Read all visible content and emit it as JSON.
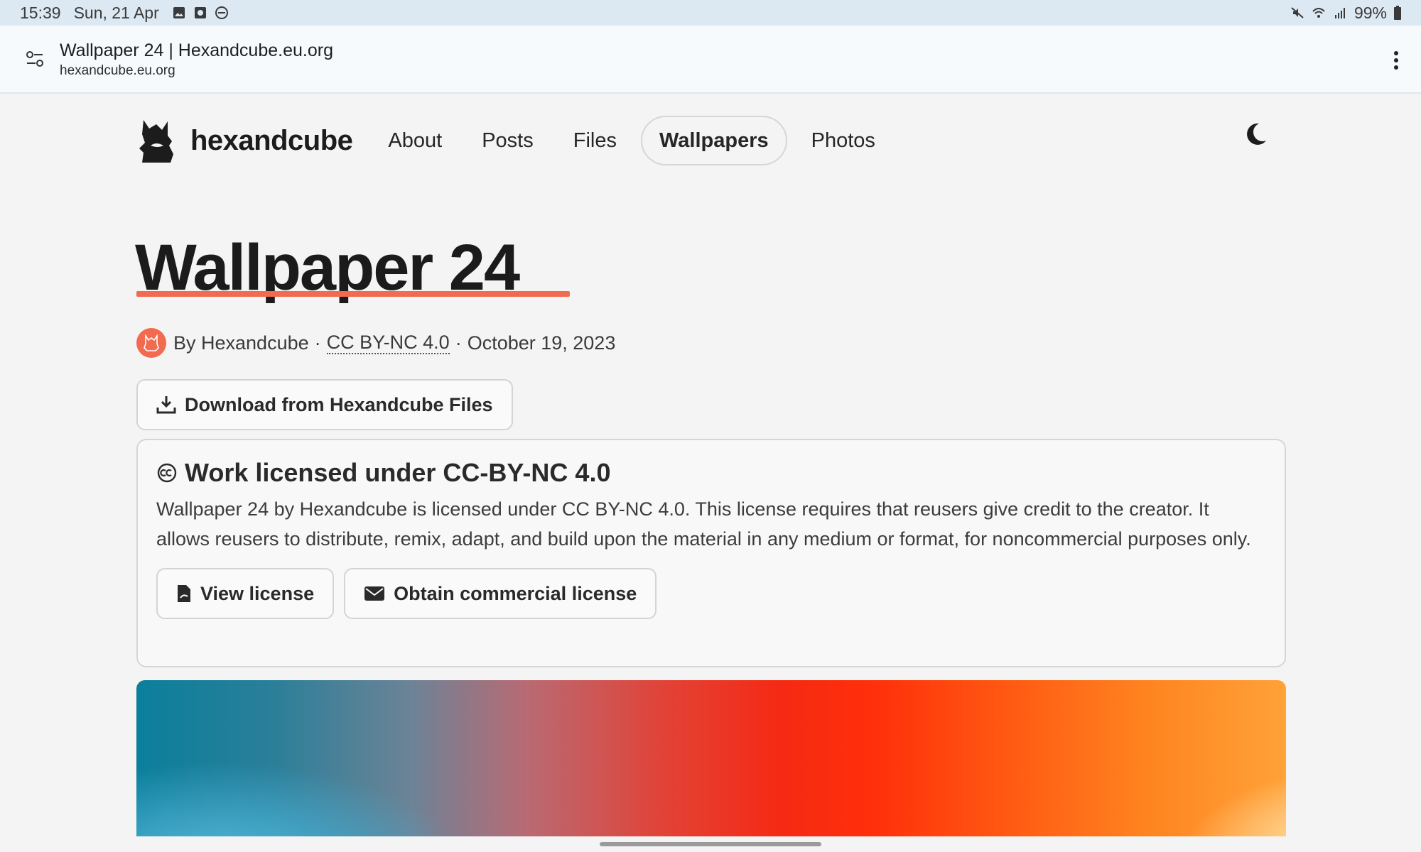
{
  "status_bar": {
    "time": "15:39",
    "date": "Sun, 21 Apr",
    "battery": "99%",
    "left_icons": [
      "gallery-icon",
      "screen-record-icon",
      "dnd-icon"
    ],
    "right_icons": [
      "mute-icon",
      "wifi-icon",
      "signal-icon",
      "battery-icon"
    ]
  },
  "browser": {
    "page_title": "Wallpaper 24 | Hexandcube.eu.org",
    "host": "hexandcube.eu.org"
  },
  "site_nav": {
    "brand": "hexandcube",
    "links": [
      {
        "label": "About"
      },
      {
        "label": "Posts"
      },
      {
        "label": "Files"
      },
      {
        "label": "Wallpapers",
        "active": true
      },
      {
        "label": "Photos"
      }
    ]
  },
  "article": {
    "title": "Wallpaper 24",
    "meta": {
      "by": "By Hexandcube",
      "separator": "·",
      "license": "CC BY-NC 4.0",
      "date": "October 19, 2023"
    },
    "download_label": "Download from Hexandcube Files"
  },
  "license_box": {
    "heading": "Work licensed under CC-BY-NC 4.0",
    "body": "Wallpaper 24 by Hexandcube is licensed under CC BY-NC 4.0. This license requires that reusers give credit to the creator. It allows reusers to distribute, remix, adapt, and build upon the material in any medium or format, for noncommercial purposes only.",
    "view_label": "View license",
    "commercial_label": "Obtain commercial license"
  },
  "colors": {
    "accent": "#f26a4f",
    "background": "#f4f4f4",
    "status_bar": "#dce8f2"
  }
}
